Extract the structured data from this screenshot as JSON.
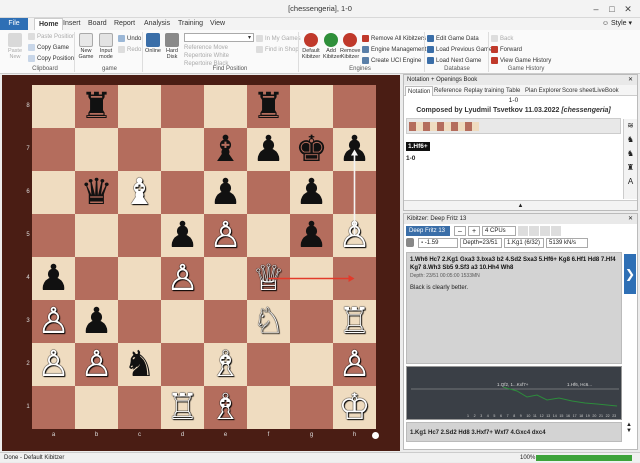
{
  "window": {
    "title": "[chessengeria], 1-0",
    "style_label": "Style"
  },
  "menu": {
    "file": "File",
    "tabs": [
      "Home",
      "Insert",
      "Board",
      "Report",
      "Analysis",
      "Training",
      "View"
    ]
  },
  "ribbon": {
    "paste_new": "Paste New",
    "paste_position": "Paste Position",
    "copy_game": "Copy Game",
    "copy_position": "Copy Position",
    "clipboard_group": "Clipboard",
    "new_game": "New Game",
    "input_mode": "Input mode",
    "undo": "Undo",
    "redo": "Redo",
    "game_group": "game",
    "online": "Online",
    "hard_disk": "Hard Disk",
    "reference_move": "Reference Move",
    "repertoire_white": "Repertoire White",
    "repertoire_black": "Repertoire Black",
    "in_my_games": "In My Games",
    "find_in_shop": "Find in Shop",
    "find_position_group": "Find Position",
    "default_kibitzer": "Default Kibitzer",
    "add_kibitzer": "Add Kibitzer",
    "remove_kibitzer": "Remove Kibitzer",
    "remove_all_kibitzers": "Remove All Kibitzers",
    "engine_management": "Engine Management",
    "create_uci_engine": "Create UCI Engine",
    "engines_group": "Engines",
    "edit_game_data": "Edit Game Data",
    "load_previous_game": "Load Previous Game",
    "load_next_game": "Load Next Game",
    "database_group": "Database",
    "back": "Back",
    "forward": "Forward",
    "view_game_history": "View Game History",
    "game_history_group": "Game History"
  },
  "board": {
    "ranks": [
      "8",
      "7",
      "6",
      "5",
      "4",
      "3",
      "2",
      "1"
    ],
    "files": [
      "a",
      "b",
      "c",
      "d",
      "e",
      "f",
      "g",
      "h"
    ],
    "pieces": [
      {
        "sq": "b8",
        "g": "♜",
        "c": "b"
      },
      {
        "sq": "f8",
        "g": "♜",
        "c": "b"
      },
      {
        "sq": "e7",
        "g": "♝",
        "c": "b"
      },
      {
        "sq": "f7",
        "g": "♟",
        "c": "b"
      },
      {
        "sq": "g7",
        "g": "♚",
        "c": "b"
      },
      {
        "sq": "h7",
        "g": "♟",
        "c": "b"
      },
      {
        "sq": "b6",
        "g": "♛",
        "c": "b"
      },
      {
        "sq": "c6",
        "g": "♝",
        "c": "w"
      },
      {
        "sq": "e6",
        "g": "♟",
        "c": "b"
      },
      {
        "sq": "g6",
        "g": "♟",
        "c": "b"
      },
      {
        "sq": "d5",
        "g": "♟",
        "c": "b"
      },
      {
        "sq": "e5",
        "g": "♙",
        "c": "w"
      },
      {
        "sq": "g5",
        "g": "♟",
        "c": "b"
      },
      {
        "sq": "h5",
        "g": "♙",
        "c": "w"
      },
      {
        "sq": "a4",
        "g": "♟",
        "c": "b"
      },
      {
        "sq": "d4",
        "g": "♙",
        "c": "w"
      },
      {
        "sq": "f4",
        "g": "♕",
        "c": "w"
      },
      {
        "sq": "a3",
        "g": "♙",
        "c": "w"
      },
      {
        "sq": "b3",
        "g": "♟",
        "c": "b"
      },
      {
        "sq": "f3",
        "g": "♘",
        "c": "w"
      },
      {
        "sq": "h3",
        "g": "♖",
        "c": "w"
      },
      {
        "sq": "a2",
        "g": "♙",
        "c": "w"
      },
      {
        "sq": "b2",
        "g": "♙",
        "c": "w"
      },
      {
        "sq": "c2",
        "g": "♞",
        "c": "b"
      },
      {
        "sq": "e2",
        "g": "♗",
        "c": "w"
      },
      {
        "sq": "h2",
        "g": "♙",
        "c": "w"
      },
      {
        "sq": "d1",
        "g": "♖",
        "c": "w"
      },
      {
        "sq": "e1",
        "g": "♗",
        "c": "w"
      },
      {
        "sq": "h1",
        "g": "♔",
        "c": "w"
      }
    ],
    "arrows": [
      {
        "from": "f4",
        "to": "h4",
        "color": "#e23a2a"
      },
      {
        "from": "h5",
        "to": "h7",
        "color": "#f4f4f4"
      }
    ]
  },
  "notation": {
    "header": "Notation + Openings Book",
    "tabs": [
      "Notation",
      "Reference",
      "Replay training",
      "Table",
      "Plan Explorer",
      "Score sheet",
      "LiveBook"
    ],
    "result": "1-0",
    "composed": "Composed by Lyudmil Tsvetkov 11.03.2022",
    "source": "[chessengeria]",
    "move": "1.Hf6+",
    "result2": "1-0"
  },
  "kibitzer": {
    "header": "Kibitzer: Deep Fritz 13",
    "engine": "Deep Fritz 13",
    "cpus": "4 CPUs",
    "eval": "-1.59",
    "depth": "Depth=23/51",
    "best": "1.Kg1 (6/32)",
    "speed": "5139 kN/s",
    "pv": "1.Wh6 Hc7 2.Kg1 Gxa3 3.bxa3 b2 4.Sd2 Sxa3 5.Hf6+ Kg8 6.Hf1 Hd8 7.Hf4 Kg7 8.Wh3 Sb5 9.Sf3 a3 10.Hh4 Wh8",
    "pv_info": "Depth: 23/51 00:05:00 1533MN",
    "assessment": "Black is clearly better.",
    "graph_labels": [
      "1.Qf2, 1...Kxf7+",
      "1.Hf6, Hc6..."
    ],
    "graph_ticks": [
      "1",
      "2",
      "3",
      "4",
      "5",
      "6",
      "7",
      "8",
      "9",
      "10",
      "11",
      "12",
      "13",
      "14",
      "15",
      "16",
      "17",
      "18",
      "19",
      "20",
      "21",
      "22",
      "23"
    ],
    "bottom_line": "1.Kg1 Hc7 2.Sd2 Hd8 3.Hxf7+ Wxf7 4.Gxc4 dxc4"
  },
  "status": {
    "left": "Done - Default Kibitzer",
    "zoom": "100%"
  }
}
